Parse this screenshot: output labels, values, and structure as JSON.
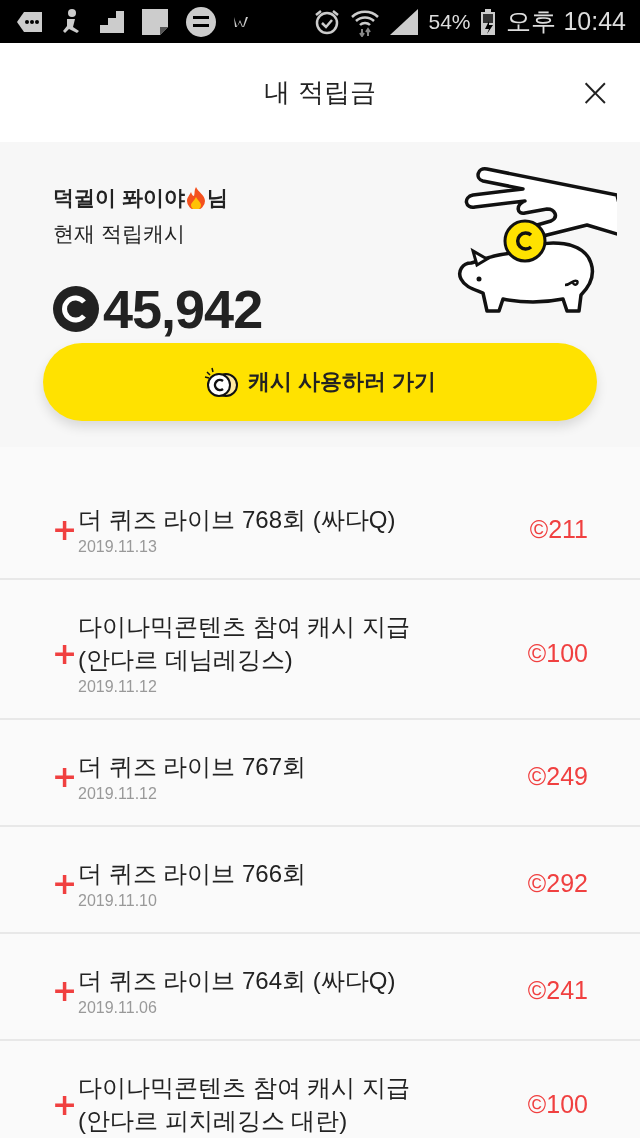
{
  "status_bar": {
    "battery": "54%",
    "time": "오후 10:44"
  },
  "header": {
    "title": "내 적립금",
    "close": "×"
  },
  "summary": {
    "user_name": "덕귈이 퐈이야",
    "honorific": "님",
    "label": "현재 적립캐시",
    "balance": "45,942",
    "button": "캐시 사용하러 가기"
  },
  "history": [
    {
      "sign": "+",
      "title": "더 퀴즈 라이브 768회 (싸다Q)",
      "date": "2019.11.13",
      "amount": "©211"
    },
    {
      "sign": "+",
      "title": "다이나믹콘텐츠 참여 캐시 지급(안다르 데님레깅스)",
      "date": "2019.11.12",
      "amount": "©100"
    },
    {
      "sign": "+",
      "title": "더 퀴즈 라이브 767회",
      "date": "2019.11.12",
      "amount": "©249"
    },
    {
      "sign": "+",
      "title": "더 퀴즈 라이브 766회",
      "date": "2019.11.10",
      "amount": "©292"
    },
    {
      "sign": "+",
      "title": "더 퀴즈 라이브 764회 (싸다Q)",
      "date": "2019.11.06",
      "amount": "©241"
    },
    {
      "sign": "+",
      "title": "다이나믹콘텐츠 참여 캐시 지급(안다르 피치레깅스 대란)",
      "amount": "©100"
    }
  ]
}
